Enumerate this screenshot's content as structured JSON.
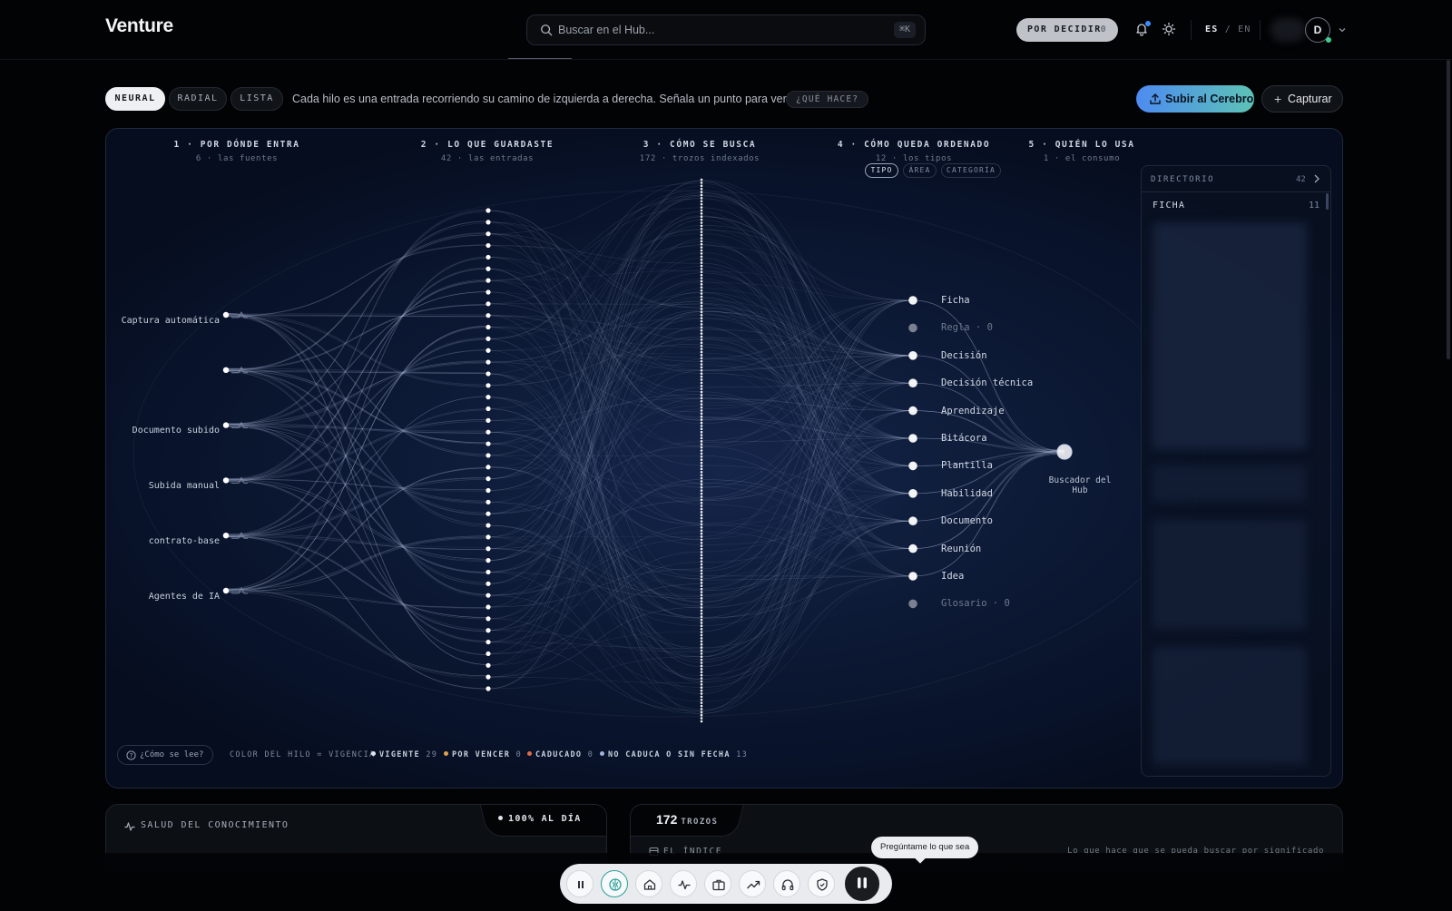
{
  "header": {
    "logo": "Venture",
    "search_placeholder": "Buscar en el Hub...",
    "search_shortcut": "⌘K",
    "decidir_label": "POR DECIDIR",
    "decidir_count": "0",
    "lang_es": "ES",
    "lang_sep": "/",
    "lang_en": "EN",
    "avatar_initial": "D"
  },
  "toolbar": {
    "modes": [
      "NEURAL",
      "RADIAL",
      "LISTA"
    ],
    "active_mode": "NEURAL",
    "hint": "Cada hilo es una entrada recorriendo su camino de izquierda a derecha. Señala un punto para ver el suyo.",
    "que_hace": "¿QUÉ HACE?",
    "subir_label": "Subir al Cerebro",
    "capturar_label": "Capturar"
  },
  "neural": {
    "columns": [
      {
        "title": "1 · POR DÓNDE ENTRA",
        "sub": "6 · las fuentes"
      },
      {
        "title": "2 · LO QUE GUARDASTE",
        "sub": "42 · las entradas"
      },
      {
        "title": "3 · CÓMO SE BUSCA",
        "sub": "172 · trozos indexados"
      },
      {
        "title": "4 · CÓMO QUEDA ORDENADO",
        "sub": "12 · los tipos"
      },
      {
        "title": "5 · QUIÉN LO USA",
        "sub": "1 · el consumo"
      }
    ],
    "type_tabs": [
      "TIPO",
      "ÁREA",
      "CATEGORÍA"
    ],
    "active_type_tab": "TIPO",
    "sources": [
      "Captura automática",
      "",
      "Documento subido",
      "Subida manual",
      "contrato-base",
      "Agentes de IA"
    ],
    "entries_count": 42,
    "chunks_count": 172,
    "types": [
      {
        "label": "Ficha",
        "dim": false
      },
      {
        "label": "Regla · 0",
        "dim": true
      },
      {
        "label": "Decisión",
        "dim": false
      },
      {
        "label": "Decisión técnica",
        "dim": false
      },
      {
        "label": "Aprendizaje",
        "dim": false
      },
      {
        "label": "Bitácora",
        "dim": false
      },
      {
        "label": "Plantilla",
        "dim": false
      },
      {
        "label": "Habilidad",
        "dim": false
      },
      {
        "label": "Documento",
        "dim": false
      },
      {
        "label": "Reunión",
        "dim": false
      },
      {
        "label": "Idea",
        "dim": false
      },
      {
        "label": "Glosario · 0",
        "dim": true
      }
    ],
    "consumer": "Buscador del Hub",
    "directory": {
      "title": "DIRECTORIO",
      "count": "42",
      "first_group": "FICHA",
      "first_group_count": "11"
    },
    "legend": {
      "como_se_lee": "¿Cómo se lee?",
      "color_hint": "COLOR DEL HILO = VIGENCIA",
      "items": [
        {
          "label": "VIGENTE",
          "count": "29",
          "color": "#dfe5ee"
        },
        {
          "label": "POR VENCER",
          "count": "0",
          "color": "#e0a24a"
        },
        {
          "label": "CADUCADO",
          "count": "0",
          "color": "#e06a4a"
        },
        {
          "label": "NO CADUCA O SIN FECHA",
          "count": "13",
          "color": "#9fb3d6"
        }
      ]
    },
    "colors": {
      "thread": "#b9c7e6",
      "node": "#ffffff"
    }
  },
  "cards": {
    "salud_title": "SALUD DEL CONOCIMIENTO",
    "salud_badge": "100% AL DÍA",
    "trozos_count": "172",
    "trozos_label": "TROZOS",
    "indice_title": "EL ÍNDICE",
    "indice_hint": "Lo que hace que se pueda buscar por significado"
  },
  "dock": {
    "tooltip": "Pregúntame lo que sea",
    "items": [
      "pause-icon",
      "brain-icon",
      "home-icon",
      "pulse-icon",
      "briefcase-icon",
      "trend-icon",
      "headphones-icon",
      "shield-icon",
      "assistant-icon"
    ]
  }
}
